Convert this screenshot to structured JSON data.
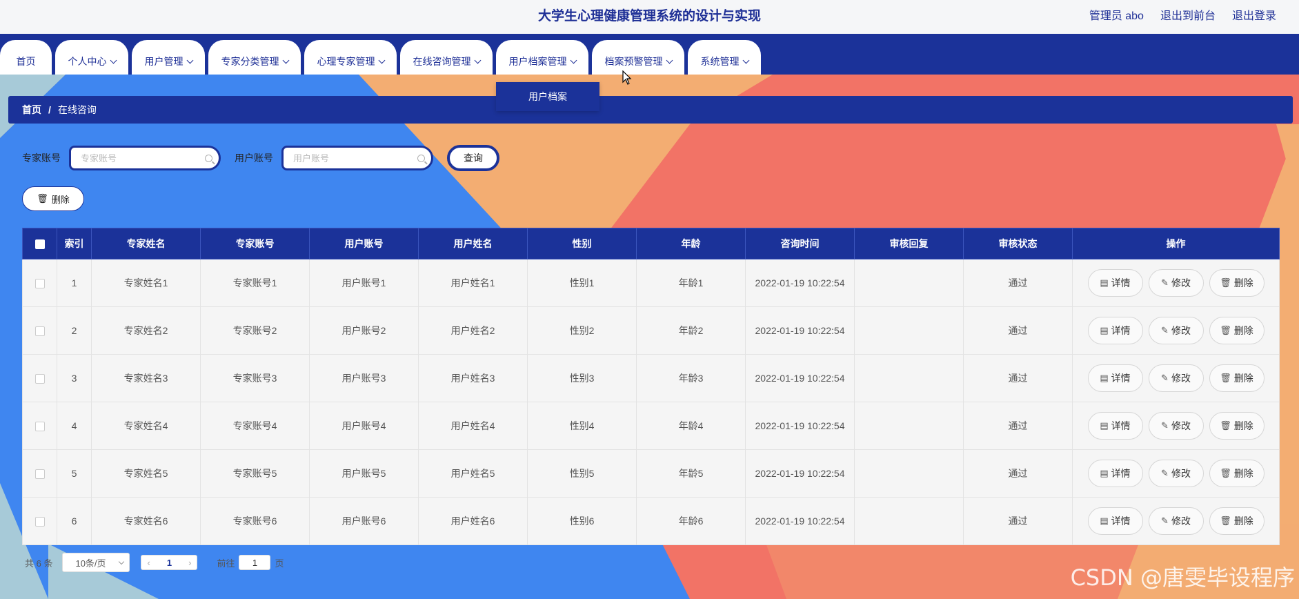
{
  "header": {
    "title": "大学生心理健康管理系统的设计与实现",
    "admin_label": "管理员 abo",
    "exit_front": "退出到前台",
    "logout": "退出登录"
  },
  "nav": {
    "items": [
      {
        "label": "首页"
      },
      {
        "label": "个人中心"
      },
      {
        "label": "用户管理"
      },
      {
        "label": "专家分类管理"
      },
      {
        "label": "心理专家管理"
      },
      {
        "label": "在线咨询管理"
      },
      {
        "label": "用户档案管理"
      },
      {
        "label": "档案预警管理"
      },
      {
        "label": "系统管理"
      }
    ],
    "dropdown_item": "用户档案"
  },
  "breadcrumb": {
    "home": "首页",
    "separator": "/",
    "current": "在线咨询"
  },
  "search": {
    "expert_label": "专家账号",
    "expert_placeholder": "专家账号",
    "user_label": "用户账号",
    "user_placeholder": "用户账号",
    "query_button": "查询"
  },
  "toolbar": {
    "delete_button": "删除"
  },
  "table": {
    "headers": [
      "索引",
      "专家姓名",
      "专家账号",
      "用户账号",
      "用户姓名",
      "性别",
      "年龄",
      "咨询时间",
      "审核回复",
      "审核状态",
      "操作"
    ],
    "rows": [
      {
        "index": "1",
        "expert_name": "专家姓名1",
        "expert_account": "专家账号1",
        "user_account": "用户账号1",
        "user_name": "用户姓名1",
        "gender": "性别1",
        "age": "年龄1",
        "time": "2022-01-19 10:22:54",
        "reply": "",
        "status": "通过"
      },
      {
        "index": "2",
        "expert_name": "专家姓名2",
        "expert_account": "专家账号2",
        "user_account": "用户账号2",
        "user_name": "用户姓名2",
        "gender": "性别2",
        "age": "年龄2",
        "time": "2022-01-19 10:22:54",
        "reply": "",
        "status": "通过"
      },
      {
        "index": "3",
        "expert_name": "专家姓名3",
        "expert_account": "专家账号3",
        "user_account": "用户账号3",
        "user_name": "用户姓名3",
        "gender": "性别3",
        "age": "年龄3",
        "time": "2022-01-19 10:22:54",
        "reply": "",
        "status": "通过"
      },
      {
        "index": "4",
        "expert_name": "专家姓名4",
        "expert_account": "专家账号4",
        "user_account": "用户账号4",
        "user_name": "用户姓名4",
        "gender": "性别4",
        "age": "年龄4",
        "time": "2022-01-19 10:22:54",
        "reply": "",
        "status": "通过"
      },
      {
        "index": "5",
        "expert_name": "专家姓名5",
        "expert_account": "专家账号5",
        "user_account": "用户账号5",
        "user_name": "用户姓名5",
        "gender": "性别5",
        "age": "年龄5",
        "time": "2022-01-19 10:22:54",
        "reply": "",
        "status": "通过"
      },
      {
        "index": "6",
        "expert_name": "专家姓名6",
        "expert_account": "专家账号6",
        "user_account": "用户账号6",
        "user_name": "用户姓名6",
        "gender": "性别6",
        "age": "年龄6",
        "time": "2022-01-19 10:22:54",
        "reply": "",
        "status": "通过"
      }
    ],
    "actions": {
      "detail": "详情",
      "edit": "修改",
      "delete": "删除"
    }
  },
  "pagination": {
    "total": "共 6 条",
    "page_size": "10条/页",
    "current_page": "1",
    "goto_label": "前往",
    "goto_value": "1",
    "page_suffix": "页"
  },
  "watermark": "CSDN @唐雯毕设程序",
  "colors": {
    "primary": "#1b3299",
    "bg_blue": "#3f86f0",
    "bg_peach": "#f3ad72",
    "bg_coral": "#f27366",
    "bg_lightblue": "#a7cad8"
  }
}
